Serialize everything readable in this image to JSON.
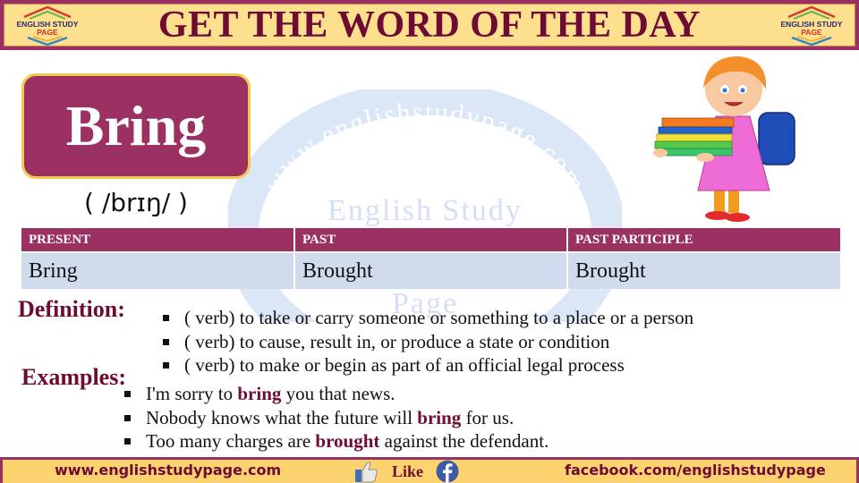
{
  "header": {
    "title": "GET THE WORD OF THE DAY",
    "logo_line1": "ENGLISH STUDY",
    "logo_line2": "PAGE"
  },
  "watermark": {
    "arc_text": "www.englishstudypage.com",
    "line1": "English Study",
    "line2": "Page"
  },
  "word": {
    "text": "Bring",
    "pronunciation": "( /brɪŋ/ )"
  },
  "illustration": {
    "icon": "child-carrying-books-illustration"
  },
  "forms_table": {
    "headers": [
      "PRESENT",
      "PAST",
      "PAST PARTICIPLE"
    ],
    "values": [
      "Bring",
      "Brought",
      "Brought"
    ]
  },
  "definition": {
    "label": "Definition:",
    "items": [
      "( verb) to take or carry someone or something to a place or a person",
      "( verb) to cause, result in, or produce a state or condition",
      "( verb) to make or begin as part of an official legal process"
    ]
  },
  "examples": {
    "label": "Examples:",
    "items": [
      {
        "before": "I'm sorry to ",
        "highlight": "bring",
        "after": " you that news."
      },
      {
        "before": "Nobody knows what the future will ",
        "highlight": "bring",
        "after": " for us."
      },
      {
        "before": "Too many charges are ",
        "highlight": "brought",
        "after": " against the defendant."
      }
    ]
  },
  "footer": {
    "website": "www.englishstudypage.com",
    "like_label": "Like",
    "facebook": "facebook.com/englishstudypage"
  },
  "colors": {
    "brand_maroon": "#9b3163",
    "title_text": "#6e0b35",
    "banner_yellow": "#fde08d",
    "footer_yellow": "#fdd36f",
    "table_row": "#d0dcee",
    "watermark_blue": "#dbe7f7"
  }
}
